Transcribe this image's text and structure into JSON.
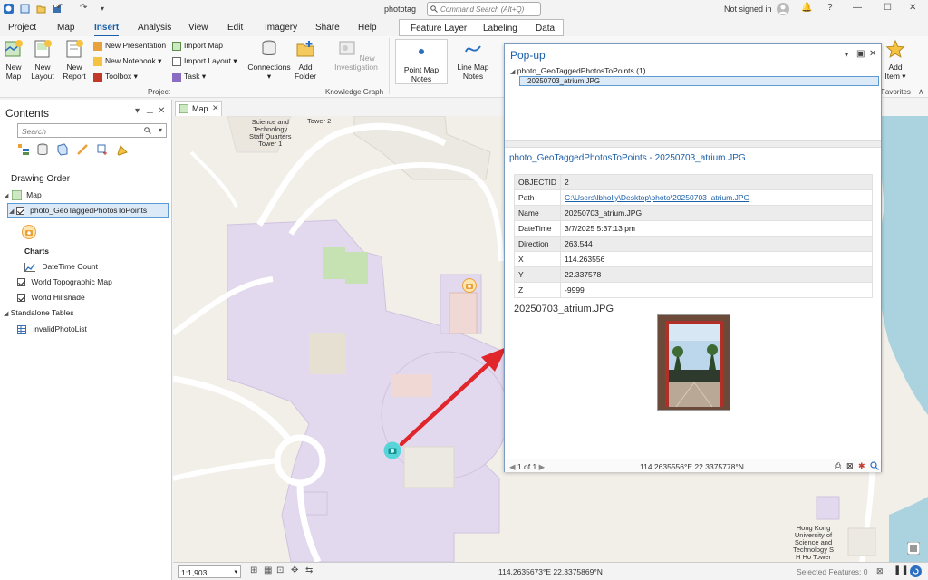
{
  "titlebar": {
    "app_title": "phototag",
    "command_search_placeholder": "Command Search (Alt+Q)",
    "sign_in": "Not signed in",
    "help": "?"
  },
  "tabs": [
    "Project",
    "Map",
    "Insert",
    "Analysis",
    "View",
    "Edit",
    "Imagery",
    "Share",
    "Help"
  ],
  "active_tab": "Insert",
  "context_tabs": [
    "Feature Layer",
    "Labeling",
    "Data"
  ],
  "ribbon": {
    "new_map": "New\nMap",
    "new_layout": "New\nLayout",
    "new_report": "New\nReport",
    "new_presentation": "New Presentation",
    "new_notebook": "New Notebook",
    "toolbox": "Toolbox",
    "import_map": "Import Map",
    "import_layout": "Import Layout",
    "task": "Task",
    "connections": "Connections",
    "add_folder": "Add\nFolder",
    "group_project": "Project",
    "new_investigation": "New\nInvestigation",
    "group_knowledge_graph": "Knowledge Graph",
    "point_map_notes": "Point Map\nNotes",
    "line_map_notes": "Line Map\nNotes",
    "add_item": "Add\nItem",
    "group_favorites": "Favorites"
  },
  "contents": {
    "title": "Contents",
    "search_placeholder": "Search",
    "drawing_order": "Drawing Order",
    "map_item": "Map",
    "layer_photo": "photo_GeoTaggedPhotosToPoints",
    "charts_label": "Charts",
    "chart_datetime": "DateTime Count",
    "layer_topo": "World Topographic Map",
    "layer_hillshade": "World Hillshade",
    "standalone_tables": "Standalone Tables",
    "table_invalid": "invalidPhotoList"
  },
  "map": {
    "tab_label": "Map",
    "labels": {
      "staff_quarters": "Science and\nTechnology\nStaff Quarters\nTower 1",
      "tower2": "Tower 2",
      "hkust": "Hong Kong\nUniversity of\nScience and\nTechnology S\nH Ho Tower"
    },
    "colors": {
      "campus_fill": "#e3d9ee",
      "road": "#ffffff",
      "green": "#c6e2b2",
      "water": "#aad3df",
      "land": "#f2efe9",
      "arrow": "#e0252b",
      "selected_point": "#3fd3d3"
    }
  },
  "status": {
    "scale": "1:1,903",
    "coords": "114.2635673°E 22.3375869°N",
    "selected_features": "Selected Features: 0"
  },
  "popup": {
    "title": "Pop-up",
    "layer_node": "photo_GeoTaggedPhotosToPoints (1)",
    "feature_node": "20250703_atrium.JPG",
    "feature_title": "photo_GeoTaggedPhotosToPoints - 20250703_atrium.JPG",
    "attributes": [
      {
        "k": "OBJECTID",
        "v": "2"
      },
      {
        "k": "Path",
        "v": "C:\\Users\\lbholly\\Desktop\\photo\\20250703_atrium.JPG"
      },
      {
        "k": "Name",
        "v": "20250703_atrium.JPG"
      },
      {
        "k": "DateTime",
        "v": "3/7/2025 5:37:13 pm"
      },
      {
        "k": "Direction",
        "v": "263.544"
      },
      {
        "k": "X",
        "v": "114.263556"
      },
      {
        "k": "Y",
        "v": "22.337578"
      },
      {
        "k": "Z",
        "v": "-9999"
      }
    ],
    "photo_title": "20250703_atrium.JPG",
    "pager": "1 of 1",
    "footer_coords": "114.2635556°E 22.3375778°N"
  }
}
